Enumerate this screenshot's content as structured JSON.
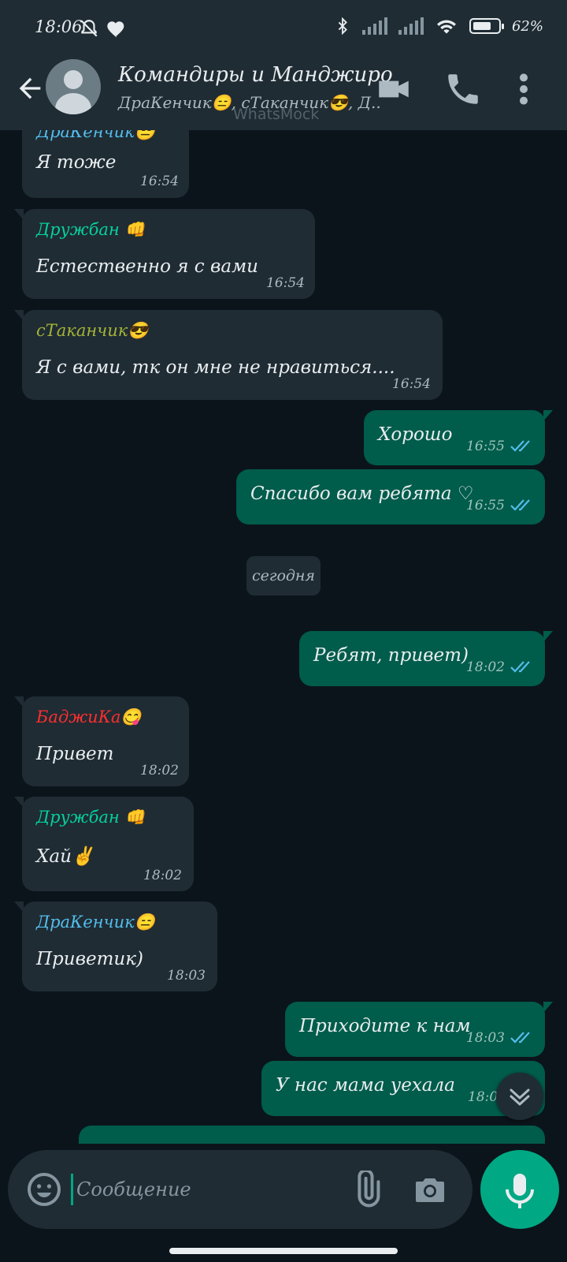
{
  "status_bar": {
    "time": "18:06",
    "left_icons": [
      "do-not-disturb-icon",
      "heart-icon"
    ],
    "right_icons": [
      "bluetooth-icon",
      "signal-icon",
      "signal-icon",
      "wifi-icon",
      "battery-icon"
    ],
    "battery_percent": "62%",
    "battery_level": 0.62
  },
  "header": {
    "back_icon": "arrow-left-icon",
    "title": "Командиры и Манджиро",
    "subtitle": "ДраКенчик😑, сТаканчик😎, Д..",
    "watermark": "WhatsMock",
    "actions": [
      "video-call-icon",
      "phone-icon",
      "more-vert-icon"
    ]
  },
  "messages": [
    {
      "dir": "in",
      "sender": "ДраКенчик😑",
      "sender_color": "#53bdeb",
      "text": "Я тоже",
      "time": "16:54"
    },
    {
      "dir": "in",
      "sender": "Дружбан 👊",
      "sender_color": "#06cf9c",
      "text": "Естественно я с вами",
      "time": "16:54"
    },
    {
      "dir": "in",
      "sender": "сТаканчик😎",
      "sender_color": "#a5b337",
      "text": "Я с вами, тк он мне не нравиться....",
      "time": "16:54"
    },
    {
      "dir": "out",
      "text": "Хорошо",
      "time": "16:55",
      "read": true
    },
    {
      "dir": "out",
      "text": "Спасибо вам ребята ♡",
      "time": "16:55",
      "read": true
    },
    {
      "dir": "out",
      "text": "Ребят, привет)",
      "time": "18:02",
      "read": true
    },
    {
      "dir": "in",
      "sender": "БаджиКа😋",
      "sender_color": "#ff2e2e",
      "text": "Привет",
      "time": "18:02"
    },
    {
      "dir": "in",
      "sender": "Дружбан 👊",
      "sender_color": "#06cf9c",
      "text": "Хай✌",
      "time": "18:02"
    },
    {
      "dir": "in",
      "sender": "ДраКенчик😑",
      "sender_color": "#53bdeb",
      "text": "Приветик)",
      "time": "18:03"
    },
    {
      "dir": "out",
      "text": "Приходите к нам",
      "time": "18:03",
      "read": true
    },
    {
      "dir": "out",
      "text": "У нас мама уехала",
      "time": "18:0"
    }
  ],
  "date_separator": "сегодня",
  "tick_color": "#53bdeb",
  "input": {
    "placeholder": "Сообщение",
    "emoji_icon": "emoji-icon",
    "attach_icon": "paperclip-icon",
    "camera_icon": "camera-icon",
    "mic_icon": "mic-icon"
  },
  "scroll_down_icon": "chevron-down-double-icon"
}
